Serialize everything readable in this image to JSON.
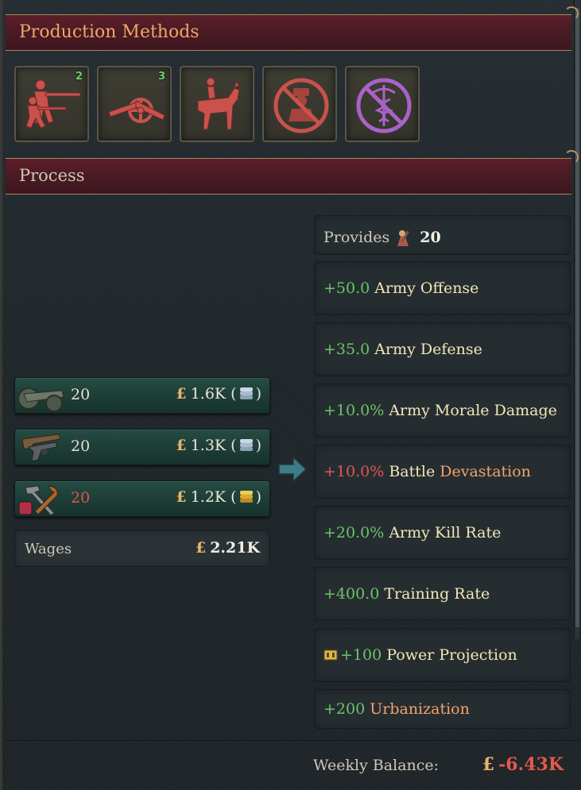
{
  "production_methods": {
    "title": "Production Methods",
    "slots": [
      {
        "icon": "infantry-rifle-icon",
        "badge": "2"
      },
      {
        "icon": "artillery-cannon-icon",
        "badge": "3"
      },
      {
        "icon": "cavalry-horse-icon",
        "badge": ""
      },
      {
        "icon": "no-mobilization-icon",
        "badge": ""
      },
      {
        "icon": "no-medical-icon",
        "badge": ""
      }
    ]
  },
  "process": {
    "title": "Process",
    "inputs": [
      {
        "good": "artillery",
        "qty": "20",
        "currency": "£",
        "cost": "1.6K",
        "paren_open": "(",
        "paren_close": ")"
      },
      {
        "good": "small-arms",
        "qty": "20",
        "currency": "£",
        "cost": "1.3K",
        "paren_open": "(",
        "paren_close": ")"
      },
      {
        "good": "tools",
        "qty": "20",
        "currency": "£",
        "cost": "1.2K",
        "paren_open": "(",
        "paren_close": ")"
      }
    ],
    "wages": {
      "label": "Wages",
      "currency": "£",
      "value": "2.21K"
    },
    "outputs": {
      "provides": {
        "label": "Provides",
        "value": "20"
      },
      "modifiers": [
        {
          "value": "+50.0",
          "label": "Army Offense"
        },
        {
          "value": "+35.0",
          "label": "Army Defense"
        },
        {
          "value": "+10.0%",
          "label": "Army Morale Damage"
        },
        {
          "value": "+10.0%",
          "label_1": "Battle",
          "label_2": "Devastation"
        },
        {
          "value": "+20.0%",
          "label": "Army Kill Rate"
        },
        {
          "value": "+400.0",
          "label": "Training Rate"
        },
        {
          "value": "+100",
          "label": "Power Projection"
        },
        {
          "value": "+200",
          "label": "Urbanization"
        }
      ]
    }
  },
  "balance": {
    "label": "Weekly Balance:",
    "currency": "£",
    "value": "-6.43K"
  },
  "colors": {
    "positive": "#6ac567",
    "negative": "#e05555",
    "header_accent": "#f0a56a",
    "header_bg": "#4a1a23"
  }
}
